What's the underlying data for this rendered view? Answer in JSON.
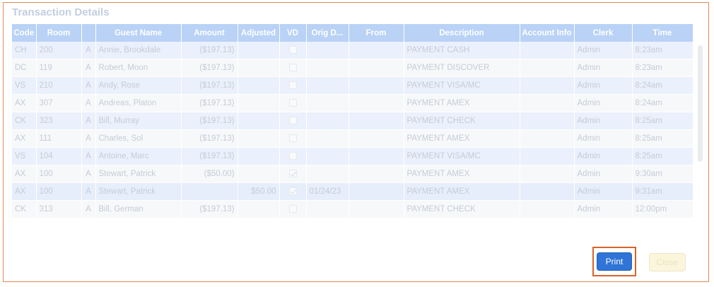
{
  "dialog": {
    "title": "Transaction Details"
  },
  "table": {
    "headers": {
      "code": "Code",
      "room": "Room",
      "type": "",
      "guest_name": "Guest Name",
      "amount": "Amount",
      "adjusted": "Adjusted",
      "vd": "VD",
      "orig_date": "Orig D...",
      "from": "From",
      "description": "Description",
      "account_info": "Account Info",
      "clerk": "Clerk",
      "time": "Time"
    },
    "rows": [
      {
        "code": "CH",
        "room": "200",
        "type": "A",
        "guest_name": "Annie, Brookdale",
        "amount": "($197.13)",
        "adjusted": "",
        "vd": false,
        "orig_date": "",
        "from": "",
        "description": "PAYMENT CASH",
        "account_info": "",
        "clerk": "Admin",
        "time": "8:23am"
      },
      {
        "code": "DC",
        "room": "119",
        "type": "A",
        "guest_name": "Robert, Moon",
        "amount": "($197.13)",
        "adjusted": "",
        "vd": false,
        "orig_date": "",
        "from": "",
        "description": "PAYMENT DISCOVER",
        "account_info": "",
        "clerk": "Admin",
        "time": "8:23am"
      },
      {
        "code": "VS",
        "room": "210",
        "type": "A",
        "guest_name": "Andy, Rose",
        "amount": "($197.13)",
        "adjusted": "",
        "vd": false,
        "orig_date": "",
        "from": "",
        "description": "PAYMENT VISA/MC",
        "account_info": "",
        "clerk": "Admin",
        "time": "8:24am"
      },
      {
        "code": "AX",
        "room": "307",
        "type": "A",
        "guest_name": "Andreas, Platon",
        "amount": "($197.13)",
        "adjusted": "",
        "vd": false,
        "orig_date": "",
        "from": "",
        "description": "PAYMENT AMEX",
        "account_info": "",
        "clerk": "Admin",
        "time": "8:24am"
      },
      {
        "code": "CK",
        "room": "323",
        "type": "A",
        "guest_name": "Bill, Murray",
        "amount": "($197.13)",
        "adjusted": "",
        "vd": false,
        "orig_date": "",
        "from": "",
        "description": "PAYMENT CHECK",
        "account_info": "",
        "clerk": "Admin",
        "time": "8:25am"
      },
      {
        "code": "AX",
        "room": "111",
        "type": "A",
        "guest_name": "Charles, Sol",
        "amount": "($197.13)",
        "adjusted": "",
        "vd": false,
        "orig_date": "",
        "from": "",
        "description": "PAYMENT AMEX",
        "account_info": "",
        "clerk": "Admin",
        "time": "8:25am"
      },
      {
        "code": "VS",
        "room": "104",
        "type": "A",
        "guest_name": "Antoine, Marc",
        "amount": "($197.13)",
        "adjusted": "",
        "vd": false,
        "orig_date": "",
        "from": "",
        "description": "PAYMENT VISA/MC",
        "account_info": "",
        "clerk": "Admin",
        "time": "8:25am"
      },
      {
        "code": "AX",
        "room": "100",
        "type": "A",
        "guest_name": "Stewart, Patrick",
        "amount": "($50.00)",
        "adjusted": "",
        "vd": true,
        "orig_date": "",
        "from": "",
        "description": "PAYMENT AMEX",
        "account_info": "",
        "clerk": "Admin",
        "time": "9:30am"
      },
      {
        "code": "AX",
        "room": "100",
        "type": "A",
        "guest_name": "Stewart, Patrick",
        "amount": "",
        "adjusted": "$50.00",
        "vd": true,
        "orig_date": "01/24/23",
        "from": "",
        "description": "PAYMENT AMEX",
        "account_info": "",
        "clerk": "Admin",
        "time": "9:31am"
      },
      {
        "code": "CK",
        "room": "313",
        "type": "A",
        "guest_name": "Bill, German",
        "amount": "($197.13)",
        "adjusted": "",
        "vd": false,
        "orig_date": "",
        "from": "",
        "description": "PAYMENT CHECK",
        "account_info": "",
        "clerk": "Admin",
        "time": "12:00pm"
      }
    ]
  },
  "buttons": {
    "print_label": "Print",
    "close_label": "Close"
  },
  "colors": {
    "header_bg": "#b9d2f6",
    "print_button": "#2f74d6",
    "highlight": "#d9622b",
    "close_button": "#fbf5dc"
  }
}
